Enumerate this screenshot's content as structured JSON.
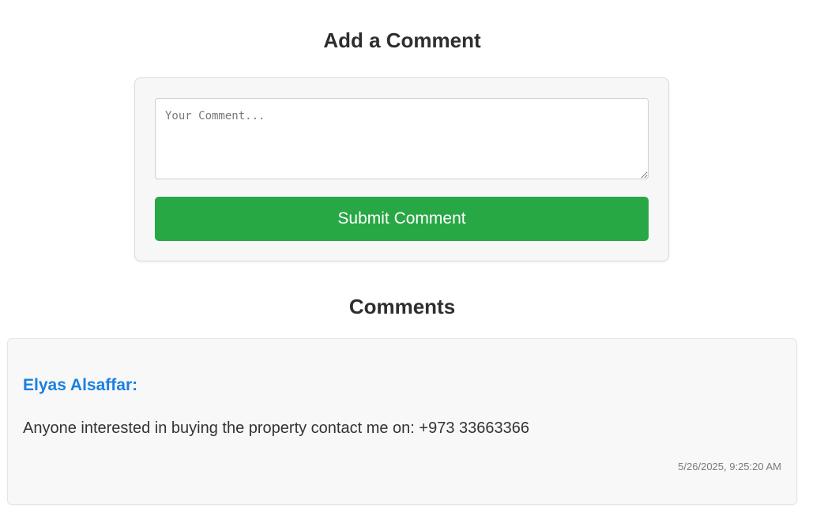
{
  "form": {
    "title": "Add a Comment",
    "textarea_placeholder": "Your Comment...",
    "textarea_value": "",
    "submit_label": "Submit Comment"
  },
  "comments_section": {
    "heading": "Comments",
    "items": [
      {
        "author": "Elyas Alsaffar:",
        "text": "Anyone interested in buying the property contact me on: +973 33663366",
        "timestamp": "5/26/2025, 9:25:20 AM"
      }
    ]
  },
  "colors": {
    "submit_button": "#28a745",
    "author_link": "#1a7fe0",
    "card_background": "#f8f8f8"
  }
}
